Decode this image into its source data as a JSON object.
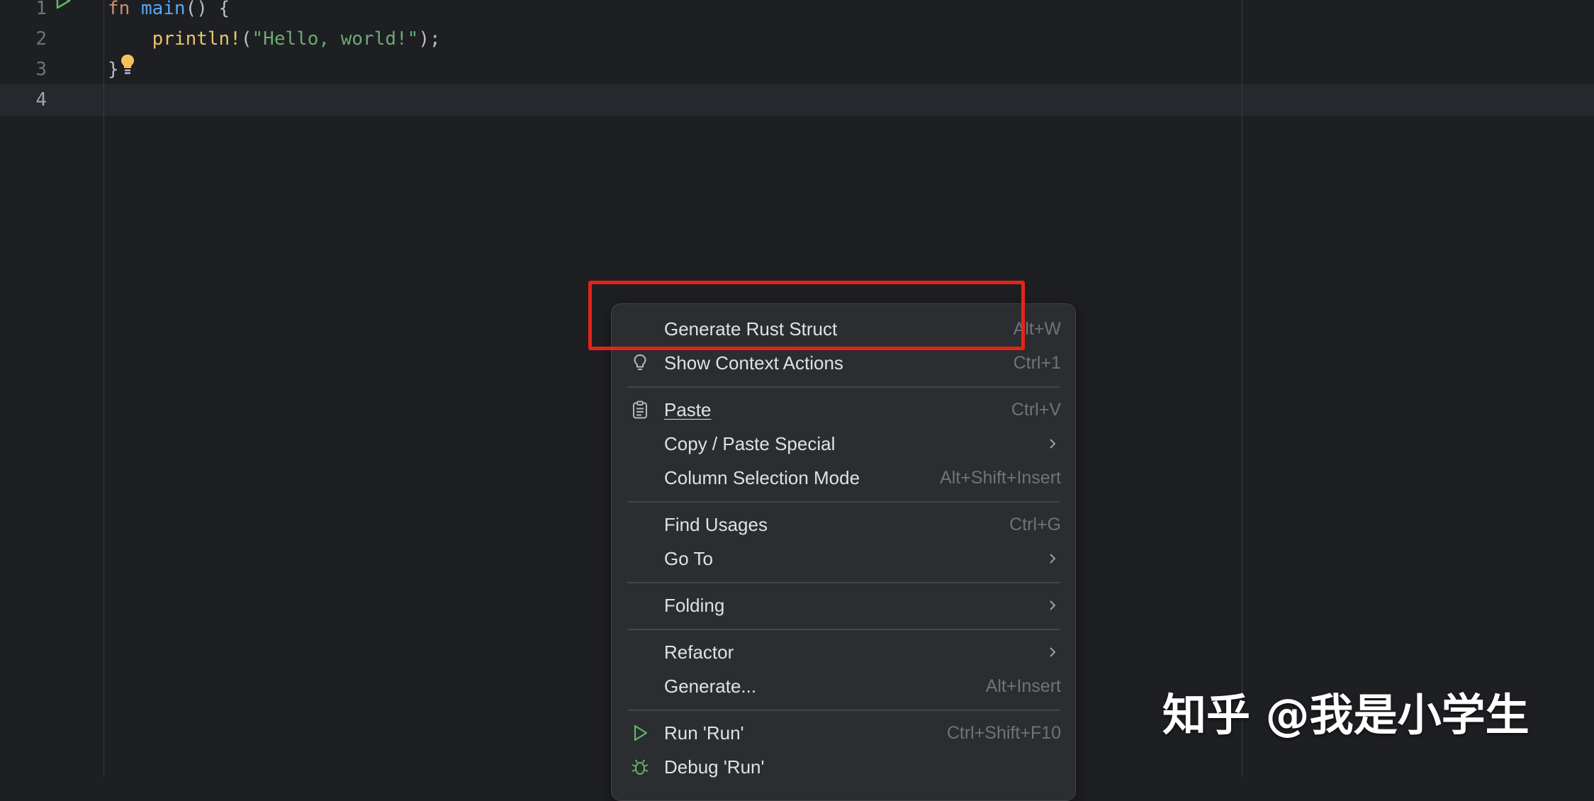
{
  "editor": {
    "lines": [
      {
        "number": "1",
        "tokens": {
          "kw": "fn",
          "fnname": "main",
          "rest": "() {"
        }
      },
      {
        "number": "2",
        "tokens": {
          "indent": "    ",
          "macro": "println!",
          "open": "(",
          "str": "\"Hello, world!\"",
          "close": ");"
        }
      },
      {
        "number": "3",
        "tokens": {
          "brace": "}"
        }
      },
      {
        "number": "4",
        "tokens": {}
      }
    ],
    "run_gutter_icon": "run-triangle-icon",
    "intention_icon": "lightbulb-icon"
  },
  "context_menu": {
    "items": [
      {
        "label": "Generate Rust Struct",
        "shortcut": "Alt+W"
      },
      {
        "label": "Show Context Actions",
        "shortcut": "Ctrl+1",
        "icon": "lightbulb-icon"
      },
      {
        "label": "Paste",
        "shortcut": "Ctrl+V",
        "icon": "clipboard-icon",
        "mnemonic": "P"
      },
      {
        "label": "Copy / Paste Special",
        "submenu": true
      },
      {
        "label": "Column Selection Mode",
        "shortcut": "Alt+Shift+Insert",
        "mnemonic": "M"
      },
      {
        "label": "Find Usages",
        "shortcut": "Ctrl+G",
        "mnemonic": "U"
      },
      {
        "label": "Go To",
        "submenu": true
      },
      {
        "label": "Folding",
        "submenu": true
      },
      {
        "label": "Refactor",
        "submenu": true,
        "mnemonic": "R"
      },
      {
        "label": "Generate...",
        "shortcut": "Alt+Insert"
      },
      {
        "label": "Run 'Run'",
        "shortcut": "Ctrl+Shift+F10",
        "icon": "run-icon",
        "mnemonic": "u"
      },
      {
        "label": "Debug 'Run'",
        "icon": "debug-bug-icon",
        "mnemonic": "D"
      }
    ]
  },
  "colors": {
    "highlight_box": "#e8221b",
    "run_icon": "#5fb865",
    "bulb_icon": "#f2c55c"
  },
  "watermark": "知乎 @我是小学生"
}
